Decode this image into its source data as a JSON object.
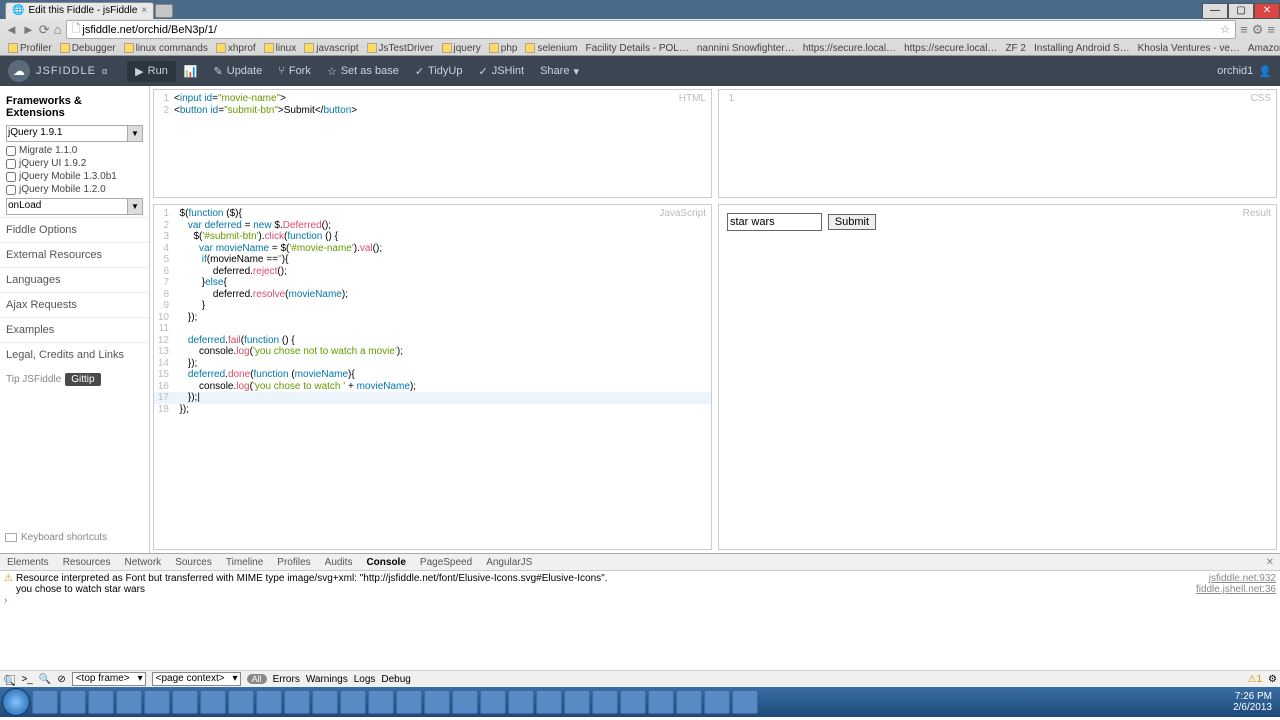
{
  "chrome": {
    "tab_title": "Edit this Fiddle - jsFiddle",
    "url": "jsfiddle.net/orchid/BeN3p/1/",
    "bookmarks": [
      "Profiler",
      "Debugger",
      "linux commands",
      "xhprof",
      "linux",
      "javascript",
      "JsTestDriver",
      "jquery",
      "php",
      "selenium",
      "Facility Details - POL…",
      "nannini Snowfighter…",
      "https://secure.local…",
      "https://secure.local…",
      "ZF 2",
      "Installing Android S…",
      "Khosla Ventures - ve…",
      "Amazon.com Associ…"
    ],
    "win": [
      "—",
      "▢",
      "✕"
    ]
  },
  "hdr": {
    "brand": "JSFIDDLE",
    "alpha": "α",
    "run": "Run",
    "update": "Update",
    "fork": "Fork",
    "setbase": "Set as base",
    "tidy": "TidyUp",
    "jshint": "JSHint",
    "share": "Share",
    "user": "orchid1"
  },
  "sidebar": {
    "frameworks": "Frameworks & Extensions",
    "lib": "jQuery 1.9.1",
    "opts": [
      "Migrate 1.1.0",
      "jQuery UI 1.9.2",
      "jQuery Mobile 1.3.0b1",
      "jQuery Mobile 1.2.0"
    ],
    "wrap": "onLoad",
    "items": [
      "Fiddle Options",
      "External Resources",
      "Languages",
      "Ajax Requests",
      "Examples",
      "Legal, Credits and Links"
    ],
    "tip": "Tip JSFiddle",
    "gittip": "Gittip",
    "kbs": "Keyboard shortcuts"
  },
  "panes": {
    "html_label": "HTML",
    "css_label": "CSS",
    "js_label": "JavaScript",
    "result_label": "Result",
    "result_input": "star wars",
    "result_btn": "Submit"
  },
  "dev": {
    "tabs": [
      "Elements",
      "Resources",
      "Network",
      "Sources",
      "Timeline",
      "Profiles",
      "Audits",
      "Console",
      "PageSpeed",
      "AngularJS"
    ],
    "warn": "Resource interpreted as Font but transferred with MIME type image/svg+xml: \"http://jsfiddle.net/font/Elusive-Icons.svg#Elusive-Icons\".",
    "src1": "jsfiddle.net:932",
    "log": "you chose to watch star wars",
    "src2": "fiddle.jshell.net:36",
    "frame": "<top frame>",
    "ctx": "<page context>",
    "ft": [
      "All",
      "Errors",
      "Warnings",
      "Logs",
      "Debug"
    ]
  },
  "tray": {
    "time": "7:26 PM",
    "date": "2/6/2013"
  }
}
